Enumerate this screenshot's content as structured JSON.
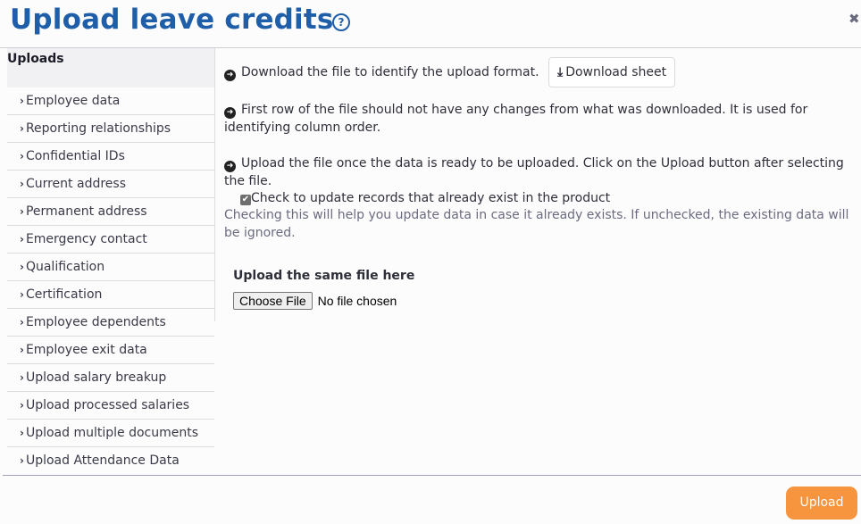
{
  "header": {
    "title": "Upload leave credits",
    "help_icon": "?",
    "close_icon": "✖"
  },
  "sidebar": {
    "heading": "Uploads",
    "items": [
      {
        "label": "Employee data"
      },
      {
        "label": "Reporting relationships"
      },
      {
        "label": "Confidential IDs"
      },
      {
        "label": "Current address"
      },
      {
        "label": "Permanent address"
      },
      {
        "label": "Emergency contact"
      },
      {
        "label": "Qualification"
      },
      {
        "label": "Certification"
      },
      {
        "label": "Employee dependents"
      },
      {
        "label": "Employee exit data"
      },
      {
        "label": "Upload salary breakup"
      },
      {
        "label": "Upload processed salaries"
      },
      {
        "label": "Upload multiple documents"
      },
      {
        "label": "Upload Attendance Data"
      }
    ]
  },
  "main": {
    "step1": "Download the file to identify the upload format.",
    "download_button": "Download sheet",
    "step2": "First row of the file should not have any changes from what was downloaded. It is used for identifying column order.",
    "step3": "Upload the file once the data is ready to be uploaded. Click on the Upload button after selecting the file.",
    "checkbox_label": "Check to update records that already exist in the product",
    "checkbox_checked": true,
    "checkbox_hint": "Checking this will help you update data in case it already exists. If unchecked, the existing data will be ignored.",
    "upload_label": "Upload the same file here",
    "choose_file_button": "Choose File",
    "file_status": "No file chosen"
  },
  "footer": {
    "upload_button": "Upload"
  },
  "colors": {
    "title": "#1f5ea8",
    "upload_button": "#f7953e"
  }
}
